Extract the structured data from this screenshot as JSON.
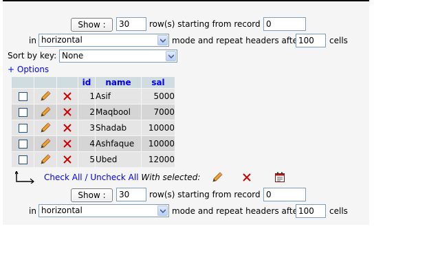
{
  "nav_top": {
    "show_label": "Show :",
    "rows_value": "30",
    "rows_text": "row(s) starting from record #",
    "start_value": "0",
    "in_text": "in",
    "mode_value": "horizontal",
    "repeat_text": "mode and repeat headers after",
    "repeat_value": "100",
    "cells_text": "cells"
  },
  "sort": {
    "label": "Sort by key:",
    "value": "None"
  },
  "options_link": "+ Options",
  "table": {
    "headers": [
      "id",
      "name",
      "sal"
    ],
    "rows": [
      {
        "id": "1",
        "name": "Asif",
        "sal": "5000"
      },
      {
        "id": "2",
        "name": "Maqbool",
        "sal": "7000"
      },
      {
        "id": "3",
        "name": "Shadab",
        "sal": "10000"
      },
      {
        "id": "4",
        "name": "Ashfaque",
        "sal": "10000"
      },
      {
        "id": "5",
        "name": "Ubed",
        "sal": "12000"
      }
    ]
  },
  "bulk": {
    "check_all": "Check All",
    "separator": "/",
    "uncheck_all": "Uncheck All",
    "with_selected": "With selected:"
  },
  "nav_bottom": {
    "show_label": "Show :",
    "rows_value": "30",
    "rows_text": "row(s) starting from record #",
    "start_value": "0",
    "in_text": "in",
    "mode_value": "horizontal",
    "repeat_text": "mode and repeat headers after",
    "repeat_value": "100",
    "cells_text": "cells"
  },
  "colors": {
    "header_bg": "#d0dce0",
    "row_odd": "#e5e5e5",
    "row_even": "#d5d5d5",
    "link": "#0000ff",
    "delete_icon": "#cc0000"
  }
}
